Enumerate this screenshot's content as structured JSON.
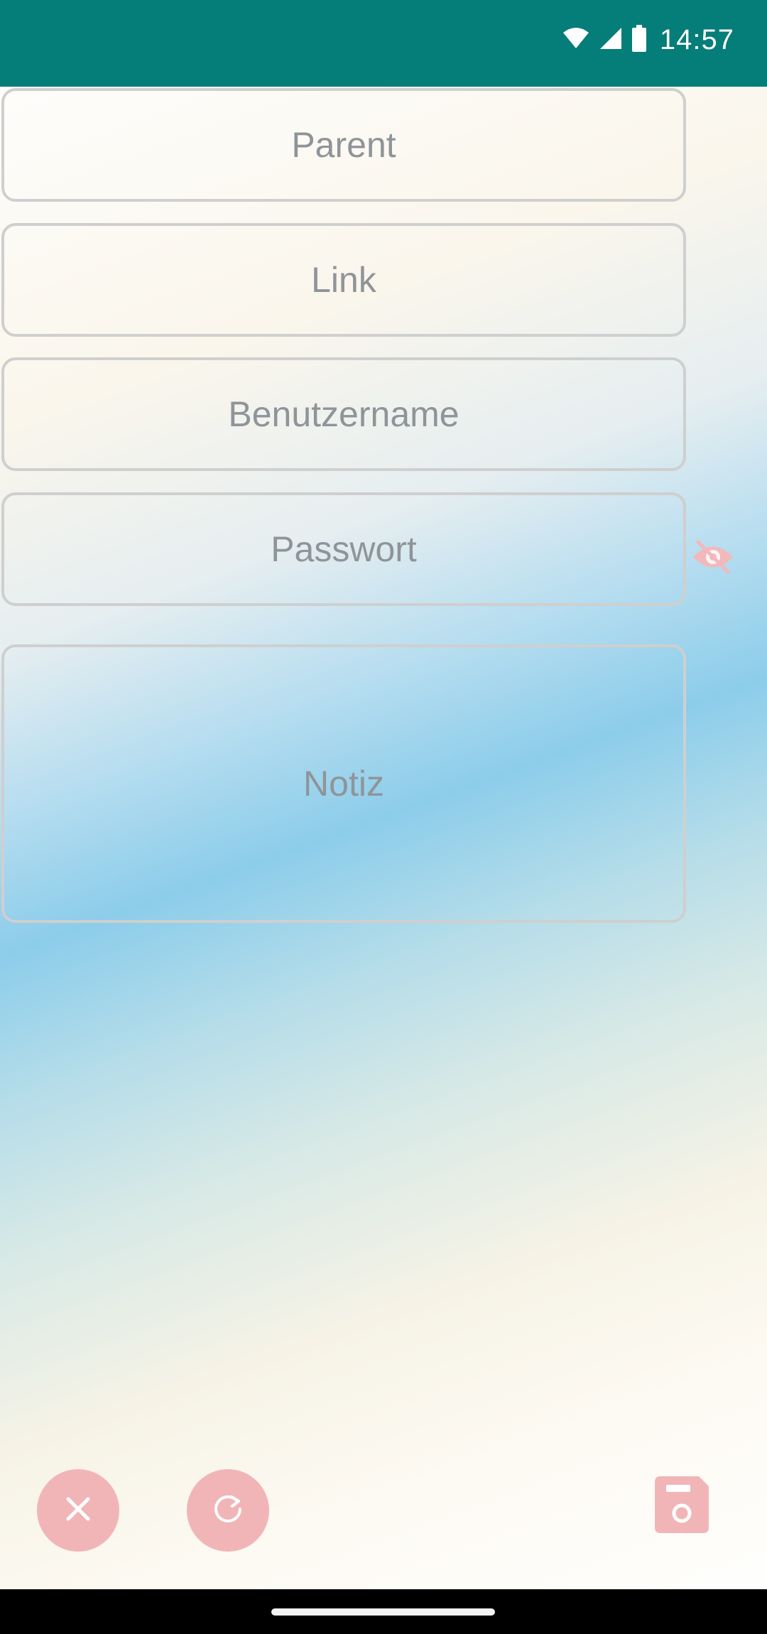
{
  "status_bar": {
    "time": "14:57",
    "icons": [
      "wifi-icon",
      "cellular-signal-icon",
      "battery-icon"
    ]
  },
  "form": {
    "parent_placeholder": "Parent",
    "link_placeholder": "Link",
    "username_placeholder": "Benutzername",
    "password_placeholder": "Passwort",
    "note_placeholder": "Notiz",
    "password_visibility_icon": "eye-off-icon"
  },
  "actions": {
    "close_icon": "close-icon",
    "reset_icon": "refresh-icon",
    "save_icon": "save-icon"
  },
  "colors": {
    "status_bar": "#057d78",
    "accent_buttons": "#f1b5b8",
    "field_border": "#cfcfcf",
    "placeholder_text": "#8f9499"
  }
}
